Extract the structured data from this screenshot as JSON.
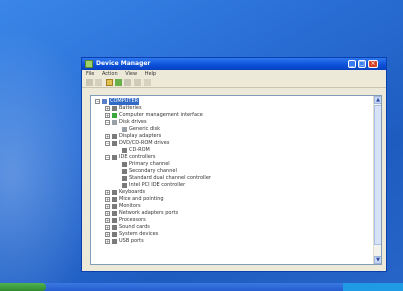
{
  "window": {
    "title": "Device Manager",
    "controls": {
      "min": "_",
      "max": "□",
      "close": "×"
    }
  },
  "menu": [
    "File",
    "Action",
    "View",
    "Help"
  ],
  "toolbar_icons": [
    "back-icon",
    "forward-icon",
    "properties-icon",
    "refresh-icon",
    "help-icon",
    "scan-icon",
    "update-icon"
  ],
  "tree": [
    {
      "level": 0,
      "expander": "−",
      "icon": "pc",
      "label": "COMPUTER",
      "selected": true
    },
    {
      "level": 1,
      "expander": "+",
      "icon": "dev",
      "label": "Batteries"
    },
    {
      "level": 1,
      "expander": "+",
      "icon": "green",
      "label": "Computer management interface"
    },
    {
      "level": 1,
      "expander": "−",
      "icon": "disk",
      "label": "Disk drives"
    },
    {
      "level": 2,
      "expander": "",
      "icon": "disk",
      "label": "Generic disk"
    },
    {
      "level": 1,
      "expander": "+",
      "icon": "dev",
      "label": "Display adapters"
    },
    {
      "level": 1,
      "expander": "−",
      "icon": "dev",
      "label": "DVD/CD-ROM drives"
    },
    {
      "level": 2,
      "expander": "",
      "icon": "dev",
      "label": "CD-ROM"
    },
    {
      "level": 1,
      "expander": "−",
      "icon": "dev",
      "label": "IDE controllers"
    },
    {
      "level": 2,
      "expander": "",
      "icon": "dev",
      "label": "Primary channel"
    },
    {
      "level": 2,
      "expander": "",
      "icon": "dev",
      "label": "Secondary channel"
    },
    {
      "level": 2,
      "expander": "",
      "icon": "dev",
      "label": "Standard dual channel controller"
    },
    {
      "level": 2,
      "expander": "",
      "icon": "dev",
      "label": "Intel PCI IDE controller"
    },
    {
      "level": 1,
      "expander": "+",
      "icon": "dev",
      "label": "Keyboards"
    },
    {
      "level": 1,
      "expander": "+",
      "icon": "dev",
      "label": "Mice and pointing"
    },
    {
      "level": 1,
      "expander": "+",
      "icon": "dev",
      "label": "Monitors"
    },
    {
      "level": 1,
      "expander": "+",
      "icon": "dev",
      "label": "Network adapters ports"
    },
    {
      "level": 1,
      "expander": "+",
      "icon": "dev",
      "label": "Processors"
    },
    {
      "level": 1,
      "expander": "+",
      "icon": "dev",
      "label": "Sound cards"
    },
    {
      "level": 1,
      "expander": "+",
      "icon": "dev",
      "label": "System devices"
    },
    {
      "level": 1,
      "expander": "+",
      "icon": "dev",
      "label": "USB ports"
    }
  ],
  "taskbar": {
    "clock": ""
  }
}
